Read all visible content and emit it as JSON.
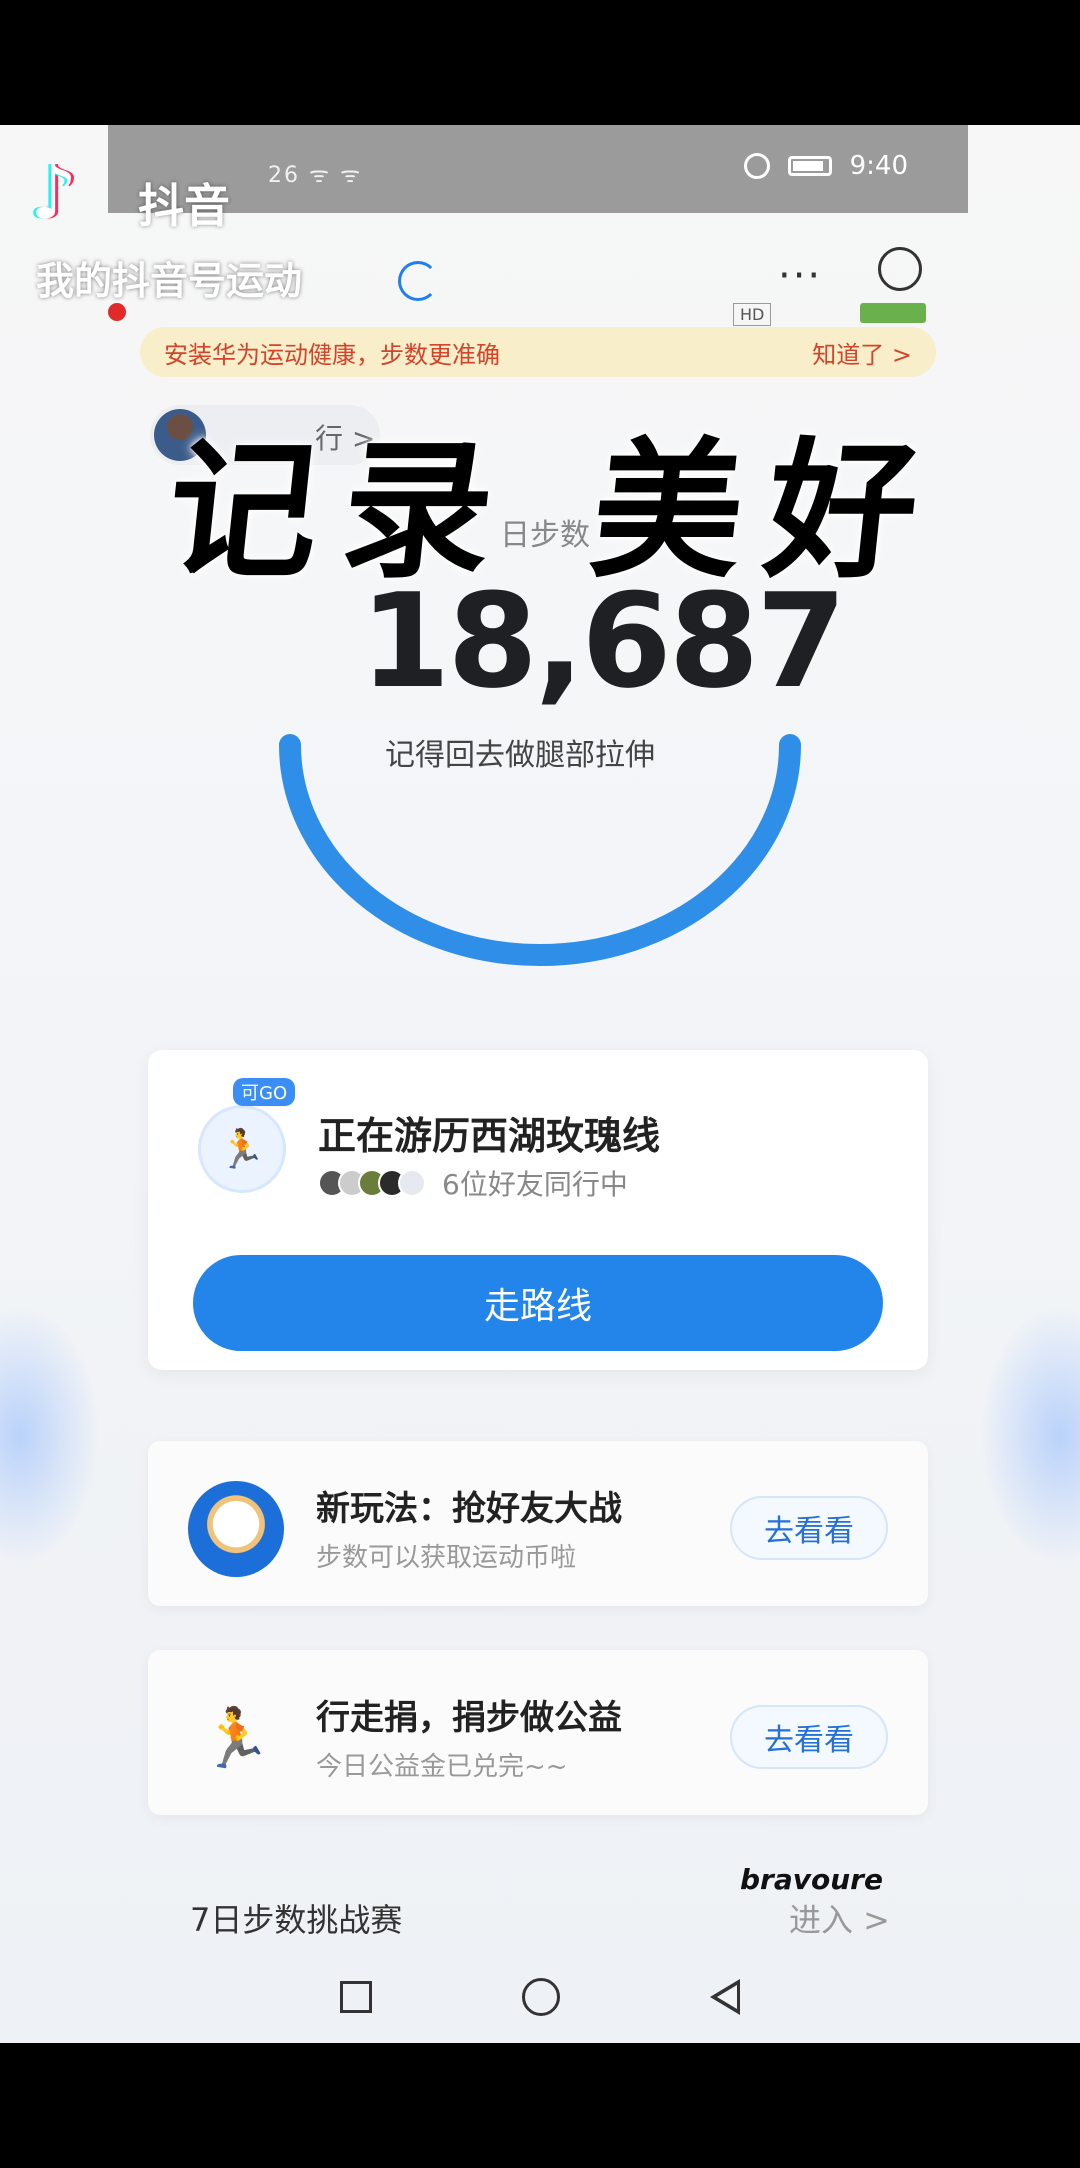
{
  "status_bar": {
    "signal_text": "26 ᯤ ᯤ",
    "time": "9:40"
  },
  "header": {
    "title": "...",
    "more": "···",
    "hd_badge": "HD"
  },
  "notice": {
    "text": "安装华为运动健康，步数更准确",
    "action": "知道了 >"
  },
  "rank": {
    "label": "行 >"
  },
  "overlay": {
    "text": "记录 美好"
  },
  "steps": {
    "label": "日步数",
    "count": "18,687",
    "tip": "记得回去做腿部拉伸",
    "progress": 1.0
  },
  "route_card": {
    "tag": "可GO",
    "title": "正在游历西湖玫瑰线",
    "friends_text": "6位好友同行中",
    "button_label": "走路线"
  },
  "feature_cards": [
    {
      "title": "新玩法：抢好友大战",
      "subtitle": "步数可以获取运动币啦",
      "button_label": "去看看",
      "icon": "girl-avatar-icon"
    },
    {
      "title": "行走捐，捐步做公益",
      "subtitle": "今日公益金已兑完~~",
      "button_label": "去看看",
      "icon": "running-man-icon"
    }
  ],
  "challenge": {
    "label": "7日步数挑战赛",
    "enter": "进入 >"
  },
  "watermark": "bravoure",
  "tiktok": {
    "app_name": "抖音",
    "account": "我的抖音号运动"
  },
  "colors": {
    "accent": "#2384ea",
    "notice_bg": "#f8eec9",
    "notice_text": "#d2442b"
  }
}
